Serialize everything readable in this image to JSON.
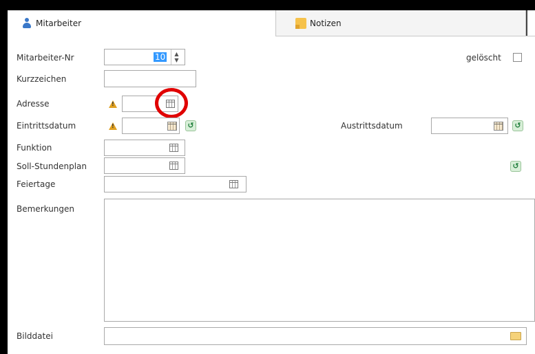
{
  "tabs": {
    "employee": {
      "icon": "person-icon",
      "label": "Mitarbeiter"
    },
    "notes": {
      "icon": "sticky-note-icon",
      "label": "Notizen"
    }
  },
  "form": {
    "employee_no": {
      "label": "Mitarbeiter-Nr",
      "value": "10"
    },
    "deleted": {
      "label": "gelöscht",
      "checked": false
    },
    "short_code": {
      "label": "Kurzzeichen",
      "value": ""
    },
    "address": {
      "label": "Adresse",
      "value": ""
    },
    "entry_date": {
      "label": "Eintrittsdatum",
      "value": ""
    },
    "exit_date": {
      "label": "Austrittsdatum",
      "value": ""
    },
    "function": {
      "label": "Funktion",
      "value": ""
    },
    "target_schedule": {
      "label": "Soll-Stundenplan",
      "value": ""
    },
    "holidays": {
      "label": "Feiertage",
      "value": ""
    },
    "remarks": {
      "label": "Bemerkungen",
      "value": ""
    },
    "image_file": {
      "label": "Bilddatei",
      "value": ""
    }
  },
  "annotation": {
    "color": "#e00000",
    "shape": "circle"
  }
}
